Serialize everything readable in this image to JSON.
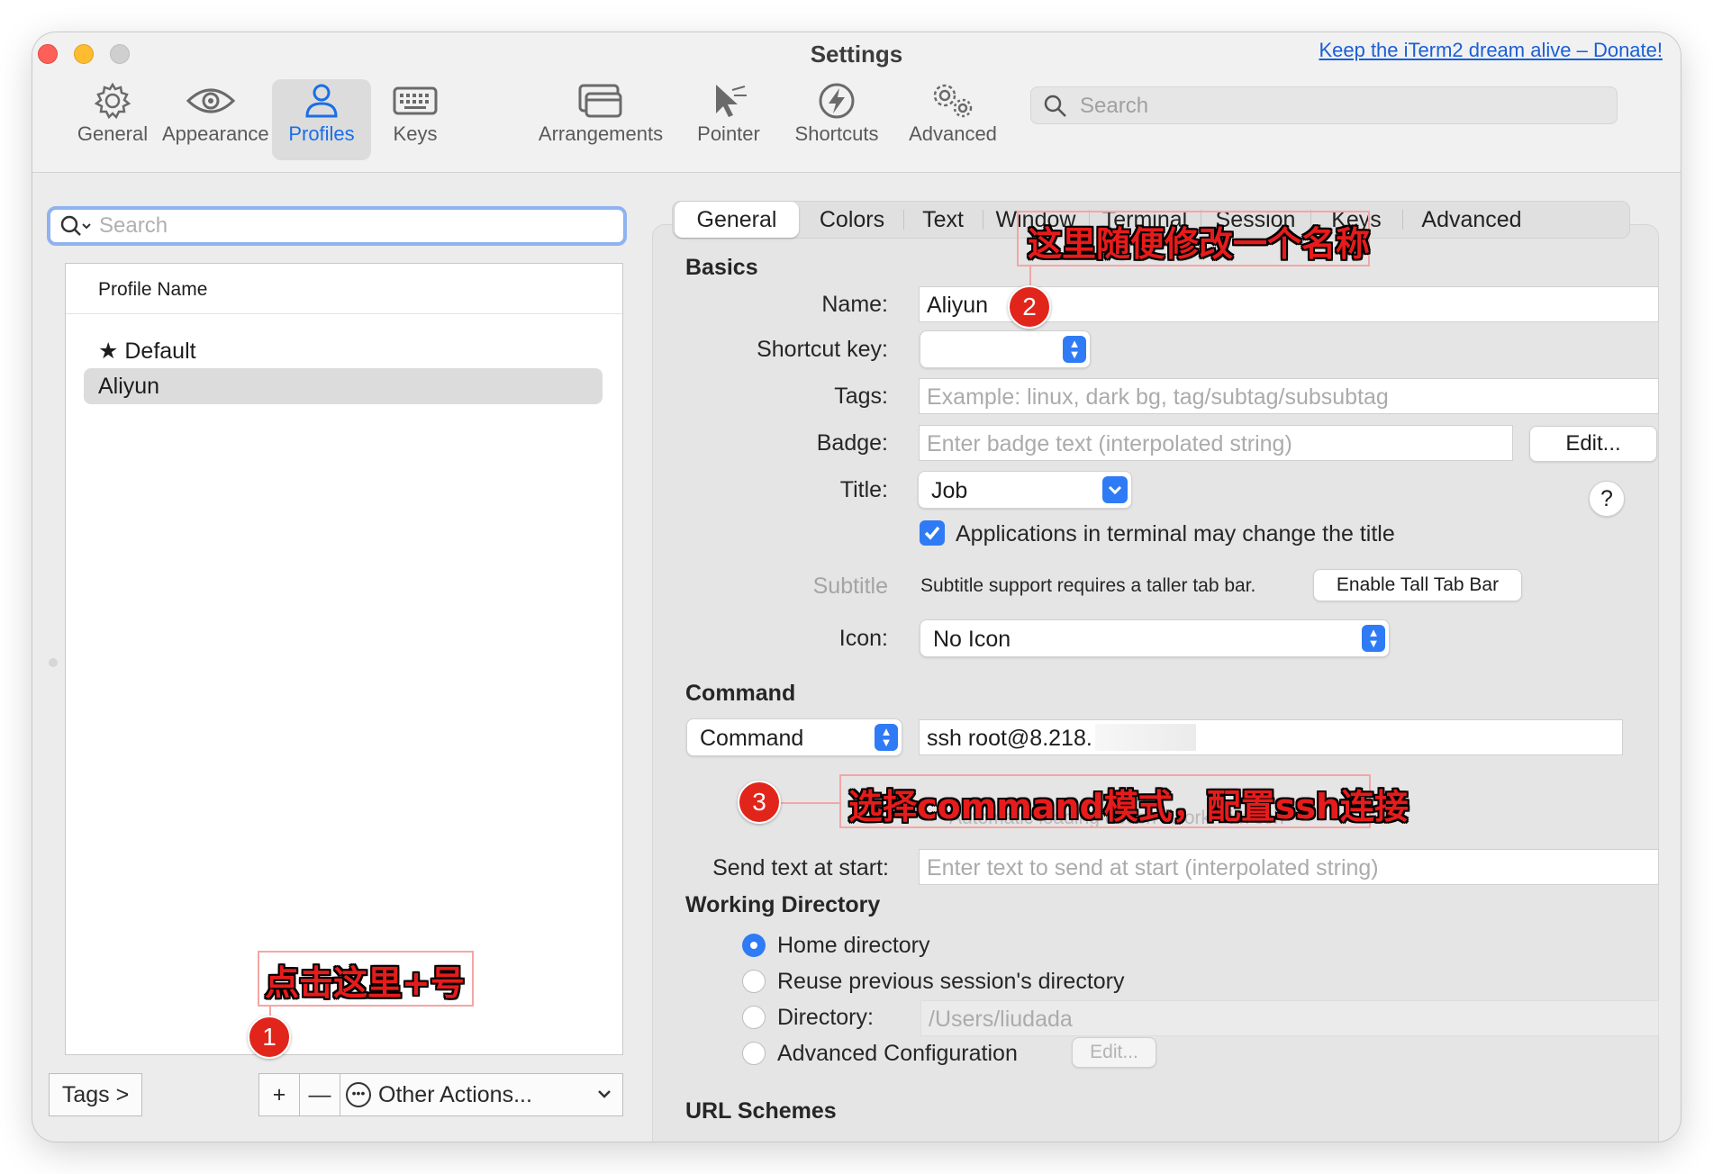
{
  "window": {
    "title": "Settings",
    "donate_link": "Keep the iTerm2 dream alive – Donate!"
  },
  "toolbar": {
    "items": [
      {
        "label": "General",
        "icon": "gear-icon"
      },
      {
        "label": "Appearance",
        "icon": "eye-icon"
      },
      {
        "label": "Profiles",
        "icon": "person-icon",
        "selected": true
      },
      {
        "label": "Keys",
        "icon": "keyboard-icon"
      },
      {
        "label": "Arrangements",
        "icon": "windows-icon"
      },
      {
        "label": "Pointer",
        "icon": "pointer-icon"
      },
      {
        "label": "Shortcuts",
        "icon": "bolt-icon"
      },
      {
        "label": "Advanced",
        "icon": "gears-icon"
      }
    ],
    "search_placeholder": "Search"
  },
  "profiles": {
    "search_placeholder": "Search",
    "column_header": "Profile Name",
    "items": [
      {
        "name": "Default",
        "star": "★",
        "selected": false
      },
      {
        "name": "Aliyun",
        "selected": true
      }
    ],
    "tags_button": "Tags >",
    "add_button": "+",
    "remove_button": "—",
    "other_actions": "Other Actions...",
    "other_actions_icon": "ellipsis-circle-icon"
  },
  "tabs": [
    "General",
    "Colors",
    "Text",
    "Window",
    "Terminal",
    "Session",
    "Keys",
    "Advanced"
  ],
  "basics": {
    "heading": "Basics",
    "name_label": "Name:",
    "name_value": "Aliyun",
    "shortcut_label": "Shortcut key:",
    "tags_label": "Tags:",
    "tags_placeholder": "Example: linux, dark bg, tag/subtag/subsubtag",
    "badge_label": "Badge:",
    "badge_placeholder": "Enter badge text (interpolated string)",
    "badge_edit": "Edit...",
    "title_label": "Title:",
    "title_value": "Job",
    "help": "?",
    "change_title_checkbox": "Applications in terminal may change the title",
    "subtitle_label": "Subtitle",
    "subtitle_note": "Subtitle support requires a taller tab bar.",
    "enable_tall_tab_bar": "Enable Tall Tab Bar",
    "icon_label": "Icon:",
    "icon_value": "No Icon"
  },
  "command": {
    "heading": "Command",
    "mode": "Command",
    "value": "ssh root@8.218.",
    "ssh_note": "Automatic loading doesn't work with ssh",
    "send_text_label": "Send text at start:",
    "send_text_placeholder": "Enter text to send at start (interpolated string)"
  },
  "working_directory": {
    "heading": "Working Directory",
    "options": [
      {
        "label": "Home directory",
        "selected": true
      },
      {
        "label": "Reuse previous session's directory",
        "selected": false
      },
      {
        "label": "Directory:",
        "selected": false
      },
      {
        "label": "Advanced Configuration",
        "selected": false
      }
    ],
    "directory_placeholder": "/Users/liudada",
    "advanced_edit": "Edit..."
  },
  "url_schemes": {
    "heading": "URL Schemes"
  },
  "annotations": [
    {
      "number": "1",
      "text": "点击这里+号"
    },
    {
      "number": "2",
      "text": "这里随便修改一个名称"
    },
    {
      "number": "3",
      "text": "选择command模式，配置ssh连接"
    }
  ],
  "colors": {
    "accent": "#2f7bf5",
    "annotation_red": "#e1251b"
  }
}
